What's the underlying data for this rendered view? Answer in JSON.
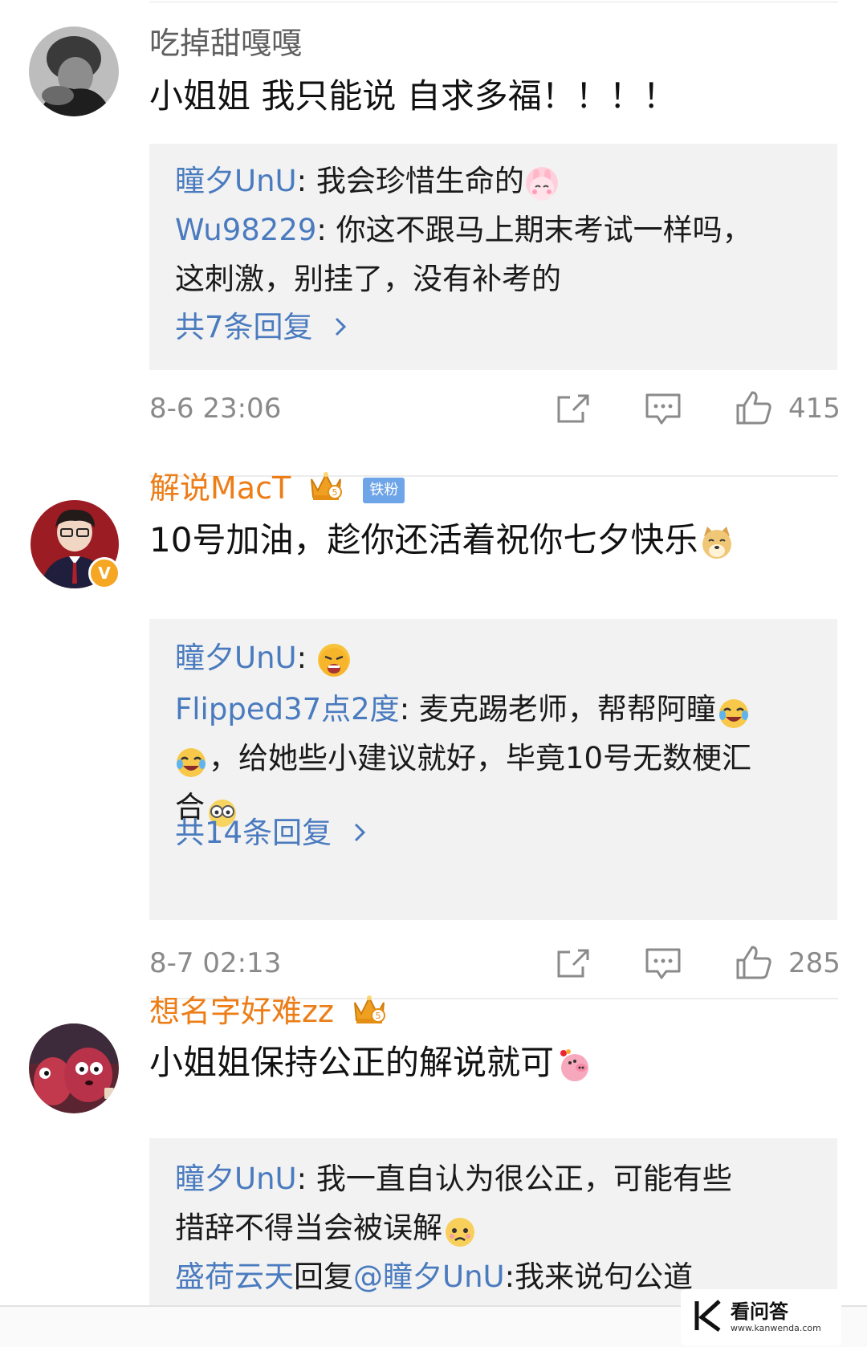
{
  "comments": [
    {
      "username": "吃掉甜嘎嘎",
      "text": "小姐姐 我只能说 自求多福！！！！",
      "replies": [
        {
          "name": "瞳夕UnU",
          "text": ": 我会珍惜生命的"
        },
        {
          "name": "Wu98229",
          "text": ": 你这不跟马上期末考试一样吗，",
          "text2": "这刺激，别挂了，没有补考的"
        }
      ],
      "more_replies": "共7条回复",
      "timestamp": "8-6 23:06",
      "likes": "415"
    },
    {
      "username": "解说MacT",
      "badge": "铁粉",
      "text": "10号加油，趁你还活着祝你七夕快乐",
      "replies": [
        {
          "name": "瞳夕UnU",
          "text": ": "
        },
        {
          "name": "Flipped37点2度",
          "text": ": 麦克踢老师，帮帮阿瞳",
          "text2": "，给她些小建议就好，毕竟10号无数梗汇",
          "text3": "合"
        }
      ],
      "more_replies": "共14条回复",
      "timestamp": "8-7 02:13",
      "likes": "285"
    },
    {
      "username": "想名字好难zz",
      "text": "小姐姐保持公正的解说就可",
      "replies": [
        {
          "name": "瞳夕UnU",
          "text": ": 我一直自认为很公正，可能有些",
          "text2": "措辞不得当会被误解"
        },
        {
          "name": "盛荷云天",
          "text": "回复",
          "mention": "@瞳夕UnU",
          "text2": ":我来说句公道"
        }
      ]
    }
  ],
  "watermark": {
    "name": "看问答",
    "url": "www.kanwenda.com"
  },
  "icons": [
    "share-icon",
    "comment-icon",
    "like-icon",
    "chevron-right-icon",
    "crown-icon",
    "verified-icon"
  ]
}
